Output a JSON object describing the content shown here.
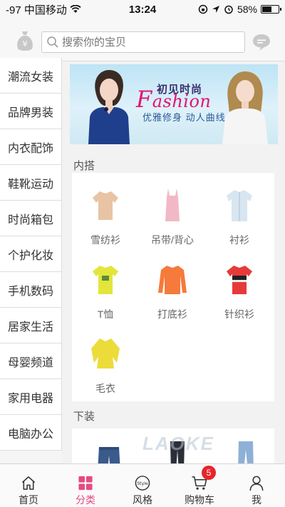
{
  "status_bar": {
    "carrier": "-97 中国移动",
    "time": "13:24",
    "battery": "58%",
    "battery_level": 0.58
  },
  "search": {
    "placeholder": "搜索你的宝贝"
  },
  "sidebar": {
    "items": [
      {
        "label": "潮流女装"
      },
      {
        "label": "品牌男装"
      },
      {
        "label": "内衣配饰"
      },
      {
        "label": "鞋靴运动"
      },
      {
        "label": "时尚箱包"
      },
      {
        "label": "个护化妆"
      },
      {
        "label": "手机数码"
      },
      {
        "label": "居家生活"
      },
      {
        "label": "母婴频道"
      },
      {
        "label": "家用电器"
      },
      {
        "label": "电脑办公"
      }
    ]
  },
  "banner": {
    "title_cn": "初见时尚",
    "title_en_first": "F",
    "title_en_rest": "ashion",
    "subtitle": "优雅修身 动人曲线"
  },
  "sections": [
    {
      "title": "内搭",
      "items": [
        {
          "label": "雪纺衫",
          "icon": "chiffon-shirt-icon",
          "color": "#e8c4a4"
        },
        {
          "label": "吊带/背心",
          "icon": "camisole-icon",
          "color": "#f2b8c6"
        },
        {
          "label": "衬衫",
          "icon": "shirt-icon",
          "color": "#d8e6f2"
        },
        {
          "label": "T恤",
          "icon": "tshirt-icon",
          "color": "#e2e63a"
        },
        {
          "label": "打底衫",
          "icon": "base-shirt-icon",
          "color": "#f57a3c"
        },
        {
          "label": "针织衫",
          "icon": "knit-shirt-icon",
          "color": "#e63a3a"
        },
        {
          "label": "毛衣",
          "icon": "sweater-icon",
          "color": "#ecdc3a"
        }
      ]
    },
    {
      "title": "下装",
      "items": []
    }
  ],
  "tabbar": {
    "items": [
      {
        "label": "首页",
        "icon": "home-icon"
      },
      {
        "label": "分类",
        "icon": "category-icon"
      },
      {
        "label": "风格",
        "icon": "style-icon"
      },
      {
        "label": "购物车",
        "icon": "cart-icon"
      },
      {
        "label": "我",
        "icon": "user-icon"
      }
    ],
    "active": "分类",
    "cart_badge": "5"
  },
  "colors": {
    "accent": "#e64a82",
    "badge": "#e8242b"
  }
}
